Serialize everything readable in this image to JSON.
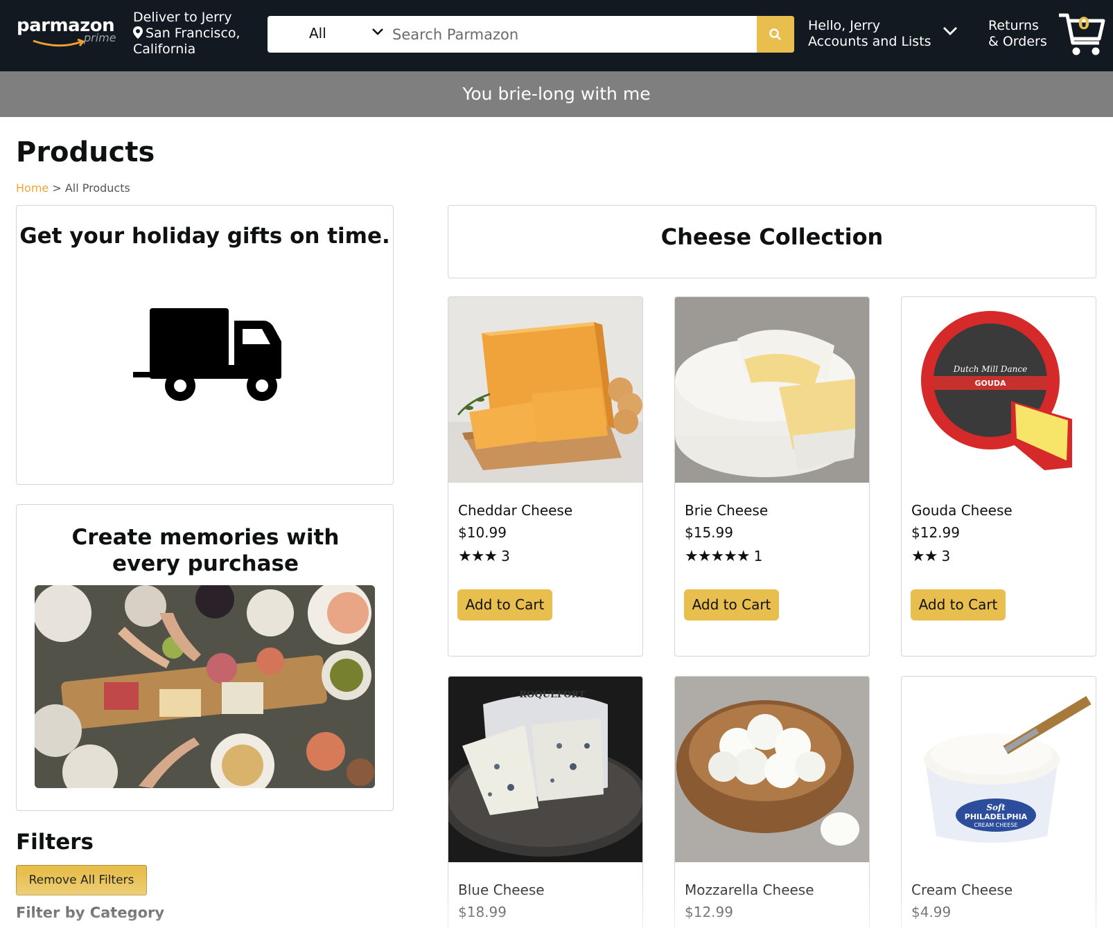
{
  "header": {
    "logo_text": "parmazon",
    "logo_sub": "prime",
    "deliver_line1": "Deliver to Jerry",
    "deliver_line2": "San Francisco,",
    "deliver_line3": "California",
    "search_category": "All",
    "search_placeholder": "Search Parmazon",
    "account_line1": "Hello, Jerry",
    "account_line2": "Accounts and Lists",
    "returns_line1": "Returns",
    "returns_line2": "& Orders",
    "cart_count": "0",
    "icons": [
      "location-pin-icon",
      "chevron-down-icon",
      "search-icon",
      "cart-icon"
    ]
  },
  "banner": {
    "text": "You brie-long with me"
  },
  "page": {
    "title": "Products",
    "breadcrumb_home": "Home",
    "breadcrumb_sep": " > ",
    "breadcrumb_current": "All Products"
  },
  "promos": {
    "holiday_title": "Get your holiday gifts on time.",
    "memories_title": "Create memories with every purchase"
  },
  "filters": {
    "title": "Filters",
    "remove_label": "Remove All Filters",
    "category_title": "Filter by Category"
  },
  "collection": {
    "title": "Cheese Collection",
    "products": [
      {
        "name": "Cheddar Cheese",
        "price": "$10.99",
        "stars": "★★★",
        "rating_count": "3",
        "cta": "Add to Cart"
      },
      {
        "name": "Brie Cheese",
        "price": "$15.99",
        "stars": "★★★★★",
        "rating_count": "1",
        "cta": "Add to Cart"
      },
      {
        "name": "Gouda Cheese",
        "price": "$12.99",
        "stars": "★★",
        "rating_count": "3",
        "cta": "Add to Cart"
      },
      {
        "name": "Blue Cheese",
        "price": "$18.99"
      },
      {
        "name": "Mozzarella Cheese",
        "price": "$12.99"
      },
      {
        "name": "Cream Cheese",
        "price": "$4.99"
      }
    ],
    "gouda_label_text": "Dutch Mill Dance",
    "gouda_label_sub": "GOUDA",
    "blue_label_text": "ROQUEFORT",
    "cream_label_brand": "Soft",
    "cream_label_name": "PHILADELPHIA",
    "cream_label_sub": "CREAM CHEESE"
  },
  "colors": {
    "header_bg": "#131921",
    "banner_bg": "#7f7f7f",
    "accent": "#e8bf4f",
    "breadcrumb_link": "#e8a736"
  }
}
